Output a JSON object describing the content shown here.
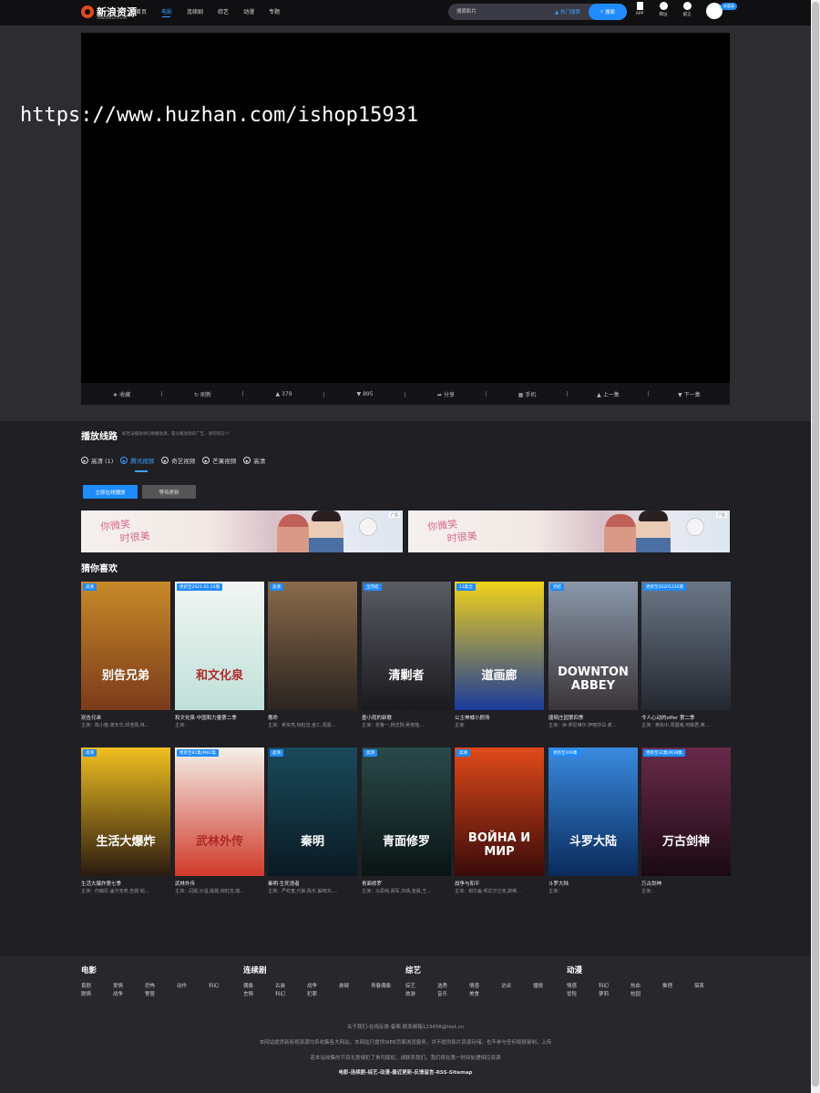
{
  "header": {
    "logo_text": "新浪资源",
    "logo_sub": "XINLANGZIYUAN",
    "nav": [
      "首页",
      "电影",
      "连续剧",
      "综艺",
      "动漫",
      "专题"
    ],
    "active_nav": "电影",
    "search_placeholder": "搜索影片",
    "hot_link": "热门搜索",
    "search_button": "搜索",
    "tools": [
      "APP",
      "网址",
      "留言"
    ],
    "login_badge": "未登录"
  },
  "watermark": "https://www.huzhan.com/ishop15931",
  "player_actions": [
    "收藏",
    "刷新",
    "379",
    "895",
    "分享",
    "手机",
    "上一集",
    "下一集"
  ],
  "play_section": {
    "title": "播放线路",
    "note": "如无法播放请切换播放源，部分播放源有广告，请勿轻信!!!",
    "tabs": [
      {
        "label": "高清 (1)",
        "active": false
      },
      {
        "label": "腾讯视频",
        "active": true
      },
      {
        "label": "奇艺视频",
        "active": false
      },
      {
        "label": "芒果视频",
        "active": false
      },
      {
        "label": "高清",
        "active": false
      }
    ],
    "buttons": [
      "立即在线播放",
      "等待更新"
    ]
  },
  "banners": [
    {
      "line1": "你微笑",
      "line2": "时很美",
      "ad_label": "广告"
    },
    {
      "line1": "你微笑",
      "line2": "时很美",
      "ad_label": "广告"
    }
  ],
  "guess": {
    "title": "猜你喜欢",
    "movies": [
      {
        "title": "别告兄弟",
        "actors": "主演：陈小春,谢天华,邓浩扬,林...",
        "badge": "高清",
        "poster_text": "别告兄弟",
        "colors": [
          "#c98a2a",
          "#7b3a1a"
        ]
      },
      {
        "title": "和文化泉·中国和力量第二季",
        "actors": "主演：",
        "badge": "更新至2021-01-24期",
        "poster_text": "和文化泉",
        "colors": [
          "#f2f6f4",
          "#bfe0d8"
        ]
      },
      {
        "title": "傲命",
        "actors": "主演：吴京亮,倪虹洁,金仁,祝嘉...",
        "badge": "高清",
        "poster_text": "",
        "colors": [
          "#8a6a4a",
          "#2b2420"
        ]
      },
      {
        "title": "墨小雨的新歌",
        "actors": "主演：张鲁一,杨志刚,吴奇隆,...",
        "badge": "全完结",
        "poster_text": "清剿者",
        "colors": [
          "#5a5c64",
          "#1a1a1e"
        ]
      },
      {
        "title": "公主神威小剧场",
        "actors": "主演：",
        "badge": "11集全",
        "poster_text": "道画廊",
        "colors": [
          "#f2d21a",
          "#1a3a9a"
        ]
      },
      {
        "title": "唐顿庄园第四季",
        "actors": "主演：休·邦尼维尔,伊丽莎白·麦...",
        "badge": "完结",
        "poster_text": "DOWNTON ABBEY",
        "colors": [
          "#8a98aa",
          "#3a3438"
        ]
      },
      {
        "title": "令人心动的offer 第二季",
        "actors": "主演：黄执中,周震南,何猷君,黄...",
        "badge": "更新至20201226期",
        "poster_text": "",
        "colors": [
          "#6a7686",
          "#242830"
        ]
      },
      {
        "title": "生活大爆炸第七季",
        "actors": "主演：约翰尼·盖尔克奇,吉姆·帕...",
        "badge": "高清",
        "poster_text": "生活大爆炸",
        "colors": [
          "#f0c020",
          "#2a1a10"
        ]
      },
      {
        "title": "武林外传",
        "actors": "主演：闫妮,沙溢,姚晨,倪虹洁,喻...",
        "badge": "更新至81集/共81集",
        "poster_text": "武林外传",
        "colors": [
          "#f4f0ea",
          "#d03a2a"
        ]
      },
      {
        "title": "秦明·生死语者",
        "actors": "主演：严屹宽,代斯,陈乐,解晓东,...",
        "badge": "高清",
        "poster_text": "秦明",
        "colors": [
          "#1a4a5a",
          "#0a1a24"
        ]
      },
      {
        "title": "青面修罗",
        "actors": "主演：马思纯,胡军,许晴,金晨,王...",
        "badge": "高清",
        "poster_text": "青面修罗",
        "colors": [
          "#2a4a4a",
          "#0a1414"
        ]
      },
      {
        "title": "战争与和平",
        "actors": "主演：谢尔盖·邦达尔丘克,斯维...",
        "badge": "高清",
        "poster_text": "ВОЙНА И МИР",
        "colors": [
          "#e04a1a",
          "#3a0a0a"
        ]
      },
      {
        "title": "斗罗大陆",
        "actors": "主演：",
        "badge": "更新至209集",
        "poster_text": "斗罗大陆",
        "colors": [
          "#3a8ae0",
          "#0a2a5a"
        ]
      },
      {
        "title": "万古剑神",
        "actors": "主演：",
        "badge": "更新至32集/共38集",
        "poster_text": "万古剑神",
        "colors": [
          "#6a2a4a",
          "#1a0a14"
        ]
      }
    ]
  },
  "footer": {
    "columns": [
      {
        "title": "电影",
        "links": [
          "喜剧",
          "爱情",
          "恐怖",
          "动作",
          "科幻",
          "剧情",
          "战争",
          "警匪"
        ]
      },
      {
        "title": "连续剧",
        "links": [
          "偶像",
          "古装",
          "战争",
          "悬疑",
          "青春偶像",
          "言情",
          "科幻",
          "犯罪"
        ]
      },
      {
        "title": "综艺",
        "links": [
          "综艺",
          "选秀",
          "情感",
          "访谈",
          "播报",
          "旅游",
          "音乐",
          "美食"
        ]
      },
      {
        "title": "动漫",
        "links": [
          "情感",
          "科幻",
          "热血",
          "推理",
          "搞笑",
          "冒险",
          "萝莉",
          "校园"
        ]
      }
    ],
    "lines": [
      "关于我们-在线反馈-备案-联系邮箱123456@test.cn",
      "本网站提供新影视资源均系收集各大网站，本网站只提供WEB页面浏览服务，并不提供影片资源存储，也不参与任何视频录制，上传",
      "若本站收集的节目无意侵犯了贵司版权，请联系我们，我们将在第一时间处理相应资源",
      "电影-连续剧-综艺-动漫-最近更新-反馈留言-RSS-Sitemap"
    ]
  }
}
